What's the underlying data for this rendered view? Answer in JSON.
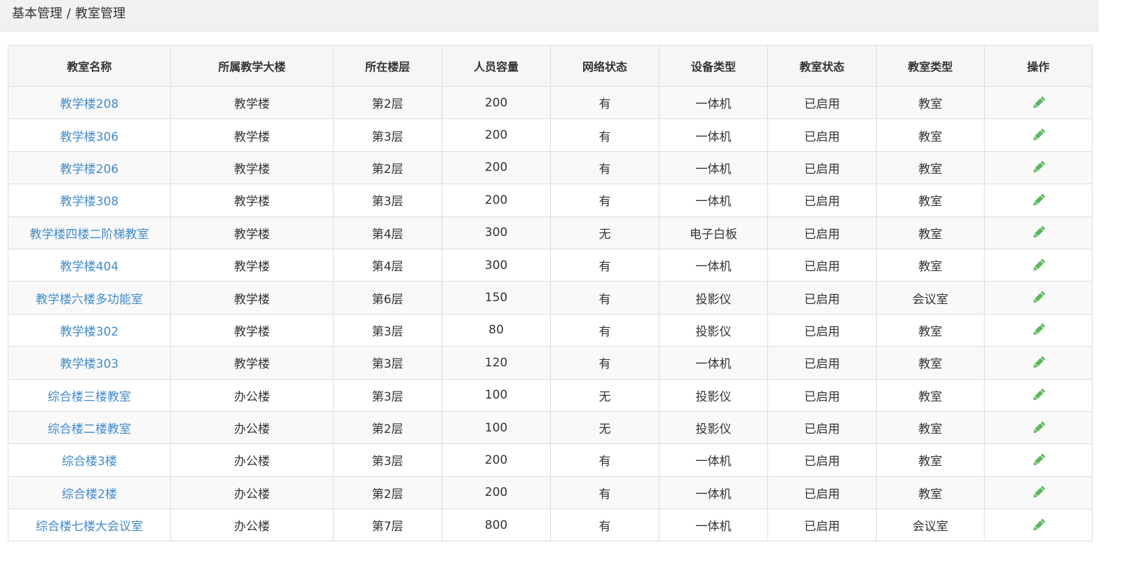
{
  "breadcrumb": {
    "parent": "基本管理",
    "separator": "/",
    "current": "教室管理"
  },
  "colors": {
    "link": "#428bca",
    "edit_icon": "#5cb85c",
    "header_bg": "#f1f1f1"
  },
  "table": {
    "headers": [
      "教室名称",
      "所属教学大楼",
      "所在楼层",
      "人员容量",
      "网络状态",
      "设备类型",
      "教室状态",
      "教室类型",
      "操作"
    ],
    "action_icon": "pencil-icon",
    "rows": [
      {
        "name": "教学楼208",
        "building": "教学楼",
        "floor": "第2层",
        "capacity": "200",
        "network": "有",
        "device": "一体机",
        "status": "已启用",
        "type": "教室"
      },
      {
        "name": "教学楼306",
        "building": "教学楼",
        "floor": "第3层",
        "capacity": "200",
        "network": "有",
        "device": "一体机",
        "status": "已启用",
        "type": "教室"
      },
      {
        "name": "教学楼206",
        "building": "教学楼",
        "floor": "第2层",
        "capacity": "200",
        "network": "有",
        "device": "一体机",
        "status": "已启用",
        "type": "教室"
      },
      {
        "name": "教学楼308",
        "building": "教学楼",
        "floor": "第3层",
        "capacity": "200",
        "network": "有",
        "device": "一体机",
        "status": "已启用",
        "type": "教室"
      },
      {
        "name": "教学楼四楼二阶梯教室",
        "building": "教学楼",
        "floor": "第4层",
        "capacity": "300",
        "network": "无",
        "device": "电子白板",
        "status": "已启用",
        "type": "教室"
      },
      {
        "name": "教学楼404",
        "building": "教学楼",
        "floor": "第4层",
        "capacity": "300",
        "network": "有",
        "device": "一体机",
        "status": "已启用",
        "type": "教室"
      },
      {
        "name": "教学楼六楼多功能室",
        "building": "教学楼",
        "floor": "第6层",
        "capacity": "150",
        "network": "有",
        "device": "投影仪",
        "status": "已启用",
        "type": "会议室"
      },
      {
        "name": "教学楼302",
        "building": "教学楼",
        "floor": "第3层",
        "capacity": "80",
        "network": "有",
        "device": "投影仪",
        "status": "已启用",
        "type": "教室"
      },
      {
        "name": "教学楼303",
        "building": "教学楼",
        "floor": "第3层",
        "capacity": "120",
        "network": "有",
        "device": "一体机",
        "status": "已启用",
        "type": "教室"
      },
      {
        "name": "综合楼三楼教室",
        "building": "办公楼",
        "floor": "第3层",
        "capacity": "100",
        "network": "无",
        "device": "投影仪",
        "status": "已启用",
        "type": "教室"
      },
      {
        "name": "综合楼二楼教室",
        "building": "办公楼",
        "floor": "第2层",
        "capacity": "100",
        "network": "无",
        "device": "投影仪",
        "status": "已启用",
        "type": "教室"
      },
      {
        "name": "综合楼3楼",
        "building": "办公楼",
        "floor": "第3层",
        "capacity": "200",
        "network": "有",
        "device": "一体机",
        "status": "已启用",
        "type": "教室"
      },
      {
        "name": "综合楼2楼",
        "building": "办公楼",
        "floor": "第2层",
        "capacity": "200",
        "network": "有",
        "device": "一体机",
        "status": "已启用",
        "type": "教室"
      },
      {
        "name": "综合楼七楼大会议室",
        "building": "办公楼",
        "floor": "第7层",
        "capacity": "800",
        "network": "有",
        "device": "一体机",
        "status": "已启用",
        "type": "会议室"
      }
    ]
  }
}
